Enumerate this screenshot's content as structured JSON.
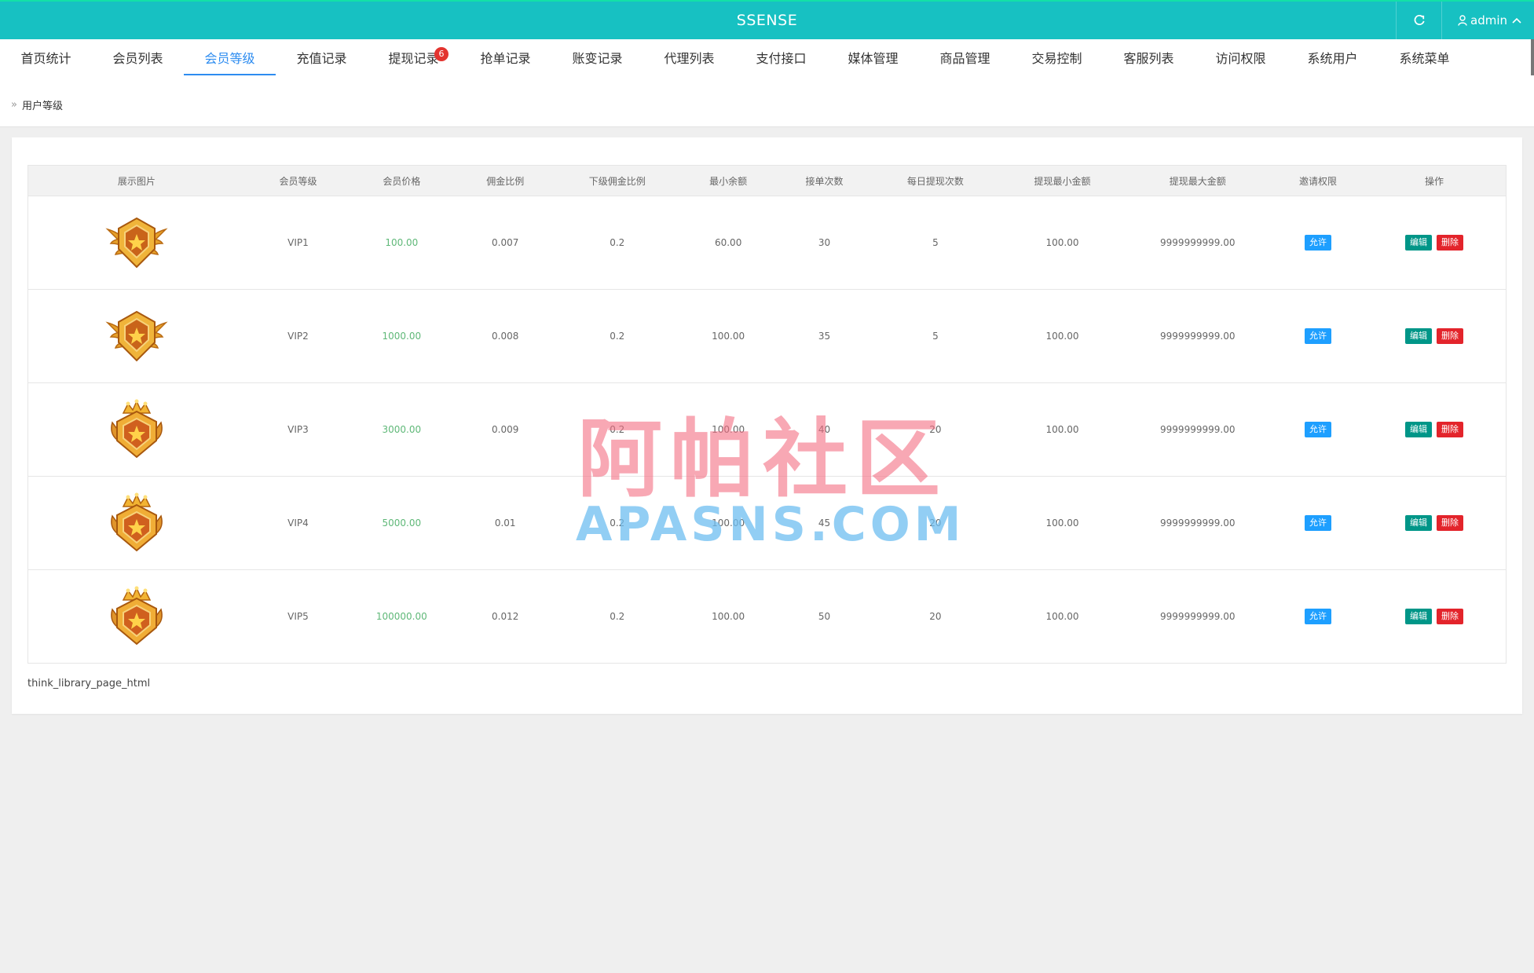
{
  "header": {
    "brand": "SSENSE",
    "user_name": "admin",
    "refresh_icon": "refresh-icon",
    "user_icon": "user-icon",
    "caret_icon": "chevron-up-icon",
    "color": "#17c1c2"
  },
  "nav": {
    "tabs": [
      {
        "label": "首页统计"
      },
      {
        "label": "会员列表"
      },
      {
        "label": "会员等级"
      },
      {
        "label": "充值记录"
      },
      {
        "label": "提现记录",
        "badge": "6"
      },
      {
        "label": "抢单记录"
      },
      {
        "label": "账变记录"
      },
      {
        "label": "代理列表"
      },
      {
        "label": "支付接口"
      },
      {
        "label": "媒体管理"
      },
      {
        "label": "商品管理"
      },
      {
        "label": "交易控制"
      },
      {
        "label": "客服列表"
      },
      {
        "label": "访问权限"
      },
      {
        "label": "系统用户"
      },
      {
        "label": "系统菜单"
      }
    ],
    "active_tab": "会员等级",
    "active_color": "#2d8cf0"
  },
  "breadcrumb": {
    "current": "用户等级"
  },
  "table": {
    "columns": [
      "展示图片",
      "会员等级",
      "会员价格",
      "佣金比例",
      "下级佣金比例",
      "最小余额",
      "接单次数",
      "每日提现次数",
      "提现最小金额",
      "提现最大金额",
      "邀请权限",
      "操作"
    ],
    "rows": [
      {
        "image": "vip-wing-badge-icon",
        "level": "VIP1",
        "price": "100.00",
        "commission": "0.007",
        "sub_commission": "0.2",
        "min_balance": "60.00",
        "orders": "30",
        "daily_withdrawals": "5",
        "withdraw_min": "100.00",
        "withdraw_max": "9999999999.00",
        "invite": "允许"
      },
      {
        "image": "vip-wing-badge-icon",
        "level": "VIP2",
        "price": "1000.00",
        "commission": "0.008",
        "sub_commission": "0.2",
        "min_balance": "100.00",
        "orders": "35",
        "daily_withdrawals": "5",
        "withdraw_min": "100.00",
        "withdraw_max": "9999999999.00",
        "invite": "允许"
      },
      {
        "image": "vip-crown-badge-icon",
        "level": "VIP3",
        "price": "3000.00",
        "commission": "0.009",
        "sub_commission": "0.2",
        "min_balance": "100.00",
        "orders": "40",
        "daily_withdrawals": "20",
        "withdraw_min": "100.00",
        "withdraw_max": "9999999999.00",
        "invite": "允许"
      },
      {
        "image": "vip-crown-badge-icon",
        "level": "VIP4",
        "price": "5000.00",
        "commission": "0.01",
        "sub_commission": "0.2",
        "min_balance": "100.00",
        "orders": "45",
        "daily_withdrawals": "20",
        "withdraw_min": "100.00",
        "withdraw_max": "9999999999.00",
        "invite": "允许"
      },
      {
        "image": "vip-crown-badge-icon",
        "level": "VIP5",
        "price": "100000.00",
        "commission": "0.012",
        "sub_commission": "0.2",
        "min_balance": "100.00",
        "orders": "50",
        "daily_withdrawals": "20",
        "withdraw_min": "100.00",
        "withdraw_max": "9999999999.00",
        "invite": "允许"
      }
    ],
    "edit_label": "编辑",
    "delete_label": "删除",
    "price_color": "#5fb878",
    "allow_color": "#1e9fff",
    "edit_color": "#009688",
    "delete_color": "#e3242b"
  },
  "pager": {
    "text": "think_library_page_html"
  },
  "watermark": {
    "cn": "阿帕社区",
    "en": "APASNS.COM"
  }
}
